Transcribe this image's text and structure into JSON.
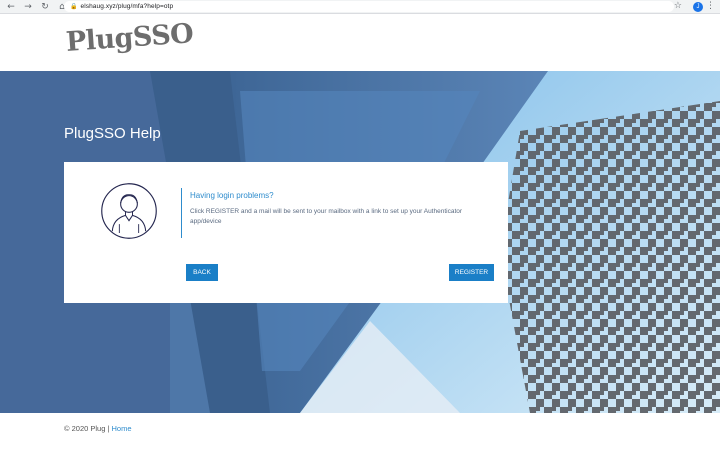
{
  "browser": {
    "back_glyph": "←",
    "forward_glyph": "→",
    "reload_glyph": "↻",
    "home_glyph": "⌂",
    "lock_glyph": "🔒",
    "url": "elshaug.xyz/plug/mfa?help=otp",
    "star_glyph": "☆",
    "profile_initial": "J",
    "menu_glyph": "⋮"
  },
  "header": {
    "logo_text": "PlugSSO"
  },
  "hero": {
    "heading": "PlugSSO Help"
  },
  "card": {
    "title": "Having login problems?",
    "body": "Click REGISTER and a mail will be sent to your mailbox with a link to set up your Authenticator app/device",
    "back_label": "BACK",
    "register_label": "REGISTER"
  },
  "footer": {
    "copyright": "© 2020 Plug |",
    "home_link": "Home"
  },
  "colors": {
    "accent": "#2e8ccd",
    "button": "#1a7fc7",
    "hero_blue": "#4c74a4",
    "sky": "#8cc4ea"
  }
}
